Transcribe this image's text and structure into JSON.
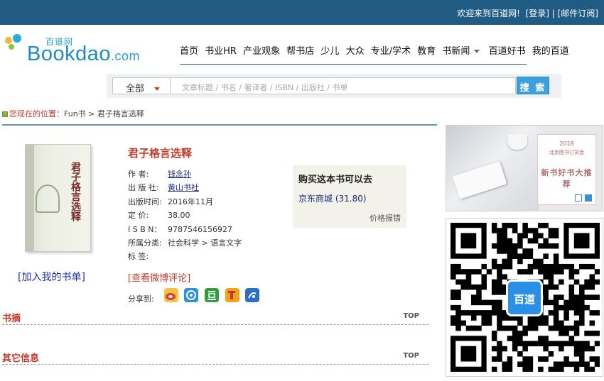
{
  "topbar": {
    "welcome": "欢迎来到百道网!",
    "login": "[登录]",
    "separator": "|",
    "mail_subscribe": "[邮件订阅]"
  },
  "logo": {
    "cn": "百道网",
    "en": "Bookdao",
    "domain": ".com"
  },
  "nav": {
    "items": [
      "首页",
      "书业HR",
      "产业观象",
      "帮书店",
      "少儿",
      "大众",
      "专业/学术",
      "教育",
      "书新闻",
      "百道好书",
      "我的百道"
    ]
  },
  "search": {
    "category": "全部",
    "placeholder": "文章标题 / 书名 / 著译者 / ISBN / 出版社 / 书单",
    "button": "搜 索"
  },
  "breadcrumb": {
    "prefix": "您现在的位置",
    "colon": "：",
    "path": "Fun书 > 君子格言选释"
  },
  "book": {
    "cover_title": "君子格言选释",
    "title": "君子格言选释",
    "add_to_list": "[加入我的书单]",
    "fields": {
      "author_label": "作    者:",
      "author": "钱念孙",
      "publisher_label": "出 版 社:",
      "publisher": "黄山书社",
      "date_label": "出版时间:",
      "date": "2016年11月",
      "price_label": "定    价:",
      "price": "38.00",
      "isbn_label": "I S B N：",
      "isbn": "9787546156927",
      "category_label": "所属分类:",
      "category": "社会科学 > 语言文字",
      "tags_label": "标    签:",
      "tags": ""
    },
    "weibo_link": "[查看微博评论]",
    "share_label": "分享到:"
  },
  "buy": {
    "heading": "购买这本书可以去",
    "store": "京东商城",
    "store_price": "(31.80)",
    "price_error": "价格报错"
  },
  "sections": [
    {
      "title": "书摘",
      "top": "TOP"
    },
    {
      "title": "其它信息",
      "top": "TOP"
    }
  ],
  "ad": {
    "year": "2018",
    "subtitle": "北京图书订货会",
    "headline": "新书好书大推荐"
  },
  "qr": {
    "center_label": "百道"
  },
  "colors": {
    "topbar": "#1f5b83",
    "accent_red": "#c0392b",
    "link_blue": "#1a2b7a",
    "search_button": "#3da1dc"
  }
}
